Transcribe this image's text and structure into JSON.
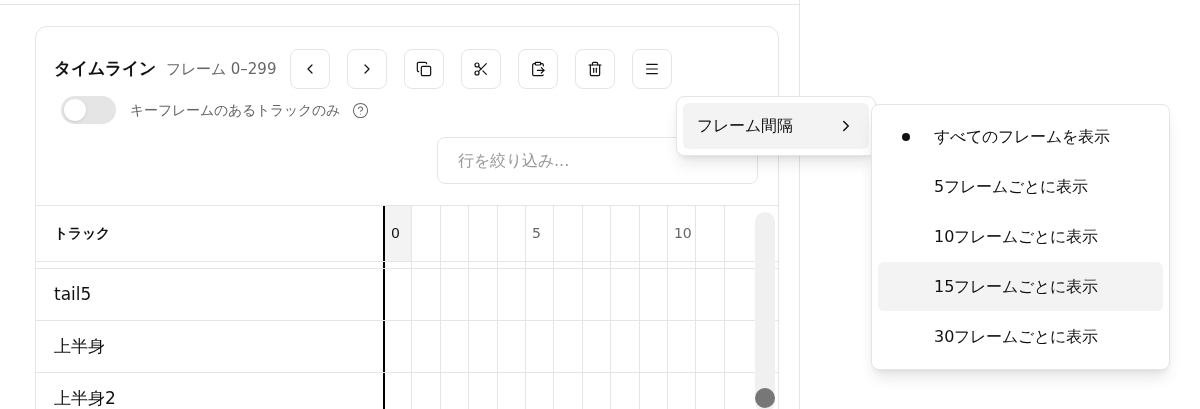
{
  "timeline": {
    "title": "タイムライン",
    "range": "フレーム 0–299"
  },
  "toggle": {
    "label": "キーフレームのあるトラックのみ",
    "on": false
  },
  "filter": {
    "placeholder": "行を絞り込み..."
  },
  "table": {
    "track_header": "トラック",
    "frame_ticks": [
      "0",
      "5",
      "10"
    ],
    "rows": [
      "tail5",
      "上半身",
      "上半身2"
    ]
  },
  "menu": {
    "items": [
      {
        "label": "フレーム間隔",
        "expanded": true
      }
    ]
  },
  "submenu": {
    "items": [
      {
        "label": "すべてのフレームを表示",
        "selected": true,
        "highlighted": false
      },
      {
        "label": "5フレームごとに表示",
        "selected": false,
        "highlighted": false
      },
      {
        "label": "10フレームごとに表示",
        "selected": false,
        "highlighted": false
      },
      {
        "label": "15フレームごとに表示",
        "selected": false,
        "highlighted": true
      },
      {
        "label": "30フレームごとに表示",
        "selected": false,
        "highlighted": false
      }
    ]
  }
}
